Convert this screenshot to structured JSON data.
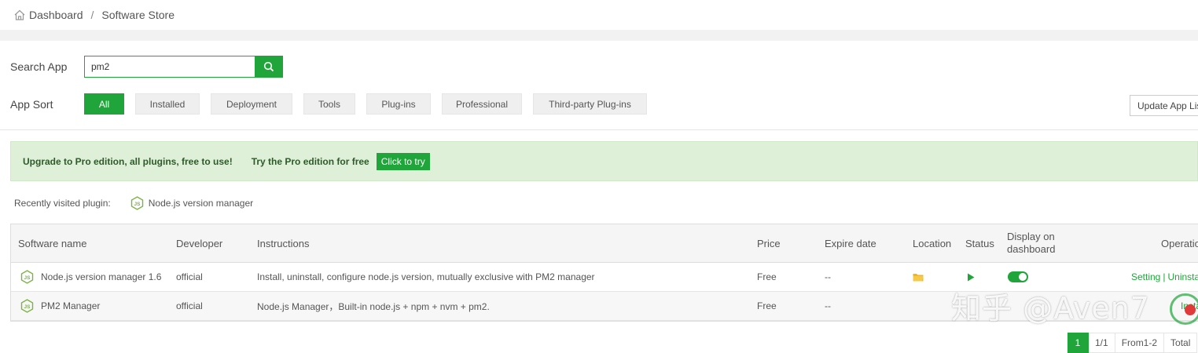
{
  "breadcrumb": {
    "home": "Dashboard",
    "separator": "/",
    "current": "Software Store"
  },
  "search": {
    "label": "Search App",
    "value": "pm2"
  },
  "sort": {
    "label": "App Sort",
    "items": [
      "All",
      "Installed",
      "Deployment",
      "Tools",
      "Plug-ins",
      "Professional",
      "Third-party Plug-ins"
    ],
    "active": "All"
  },
  "update_button": "Update App List",
  "promo": {
    "text": "Upgrade to Pro edition, all plugins, free to use!",
    "try_text": "Try the Pro edition for free",
    "try_button": "Click to try"
  },
  "recent": {
    "label": "Recently visited plugin:",
    "plugin": "Node.js version manager"
  },
  "table": {
    "headers": {
      "name": "Software name",
      "developer": "Developer",
      "instructions": "Instructions",
      "price": "Price",
      "expire": "Expire date",
      "location": "Location",
      "status": "Status",
      "display": "Display on",
      "display2": "dashboard",
      "operation": "Operation"
    },
    "rows": [
      {
        "name": "Node.js version manager 1.6",
        "developer": "official",
        "instructions": "Install, uninstall, configure node.js version, mutually exclusive with PM2 manager",
        "price": "Free",
        "expire": "--",
        "op1": "Setting",
        "op_sep": "|",
        "op2": "Uninstall"
      },
      {
        "name": "PM2 Manager",
        "developer": "official",
        "instructions": "Node.js Manager，Built-in node.js + npm + nvm + pm2.",
        "price": "Free",
        "expire": "--",
        "op1": "Install"
      }
    ]
  },
  "pager": {
    "current": "1",
    "pages": "1/1",
    "range": "From1-2",
    "total": "Total"
  },
  "watermark": "知乎 @Aven7",
  "colors": {
    "accent": "#20a53a",
    "promo_bg": "#dff0d8"
  },
  "icons": {
    "home": "home-icon",
    "search": "search-icon",
    "nodejs": "nodejs-icon",
    "folder": "folder-icon",
    "play": "play-icon"
  }
}
